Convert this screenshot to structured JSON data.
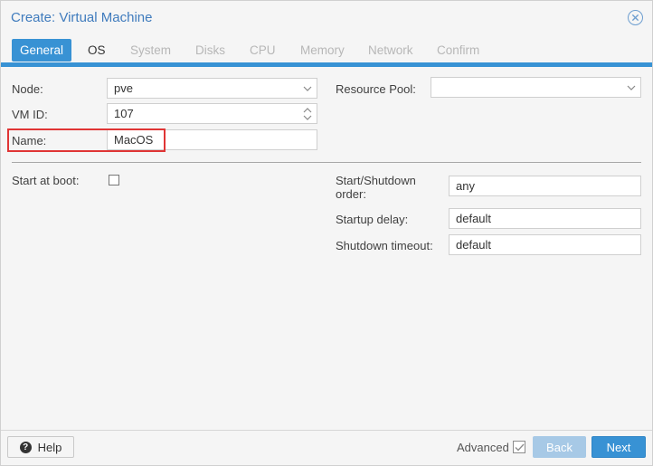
{
  "window": {
    "title": "Create: Virtual Machine"
  },
  "tabs": [
    {
      "label": "General",
      "state": "active"
    },
    {
      "label": "OS",
      "state": "enabled"
    },
    {
      "label": "System",
      "state": "disabled"
    },
    {
      "label": "Disks",
      "state": "disabled"
    },
    {
      "label": "CPU",
      "state": "disabled"
    },
    {
      "label": "Memory",
      "state": "disabled"
    },
    {
      "label": "Network",
      "state": "disabled"
    },
    {
      "label": "Confirm",
      "state": "disabled"
    }
  ],
  "form": {
    "node": {
      "label": "Node:",
      "value": "pve"
    },
    "vmid": {
      "label": "VM ID:",
      "value": "107"
    },
    "name": {
      "label": "Name:",
      "value": "MacOS"
    },
    "resource_pool": {
      "label": "Resource Pool:",
      "value": ""
    },
    "start_at_boot": {
      "label": "Start at boot:",
      "checked": false
    },
    "startup_order": {
      "label_line1": "Start/Shutdown",
      "label_line2": "order:",
      "value": "any"
    },
    "startup_delay": {
      "label": "Startup delay:",
      "value": "default"
    },
    "shutdown_timeout": {
      "label": "Shutdown timeout:",
      "value": "default"
    }
  },
  "footer": {
    "help_label": "Help",
    "help_icon_glyph": "?",
    "advanced_label": "Advanced",
    "advanced_checked": true,
    "back_label": "Back",
    "next_label": "Next"
  },
  "colors": {
    "accent": "#3892d4",
    "title": "#3f7bbd",
    "highlight": "#e03535",
    "back_disabled": "#a7c9e6"
  },
  "icons": {
    "close": "close-icon",
    "dropdown": "chevron-down-icon",
    "spinner": "spinner-arrows-icon",
    "help": "help-icon",
    "check": "check-icon"
  }
}
